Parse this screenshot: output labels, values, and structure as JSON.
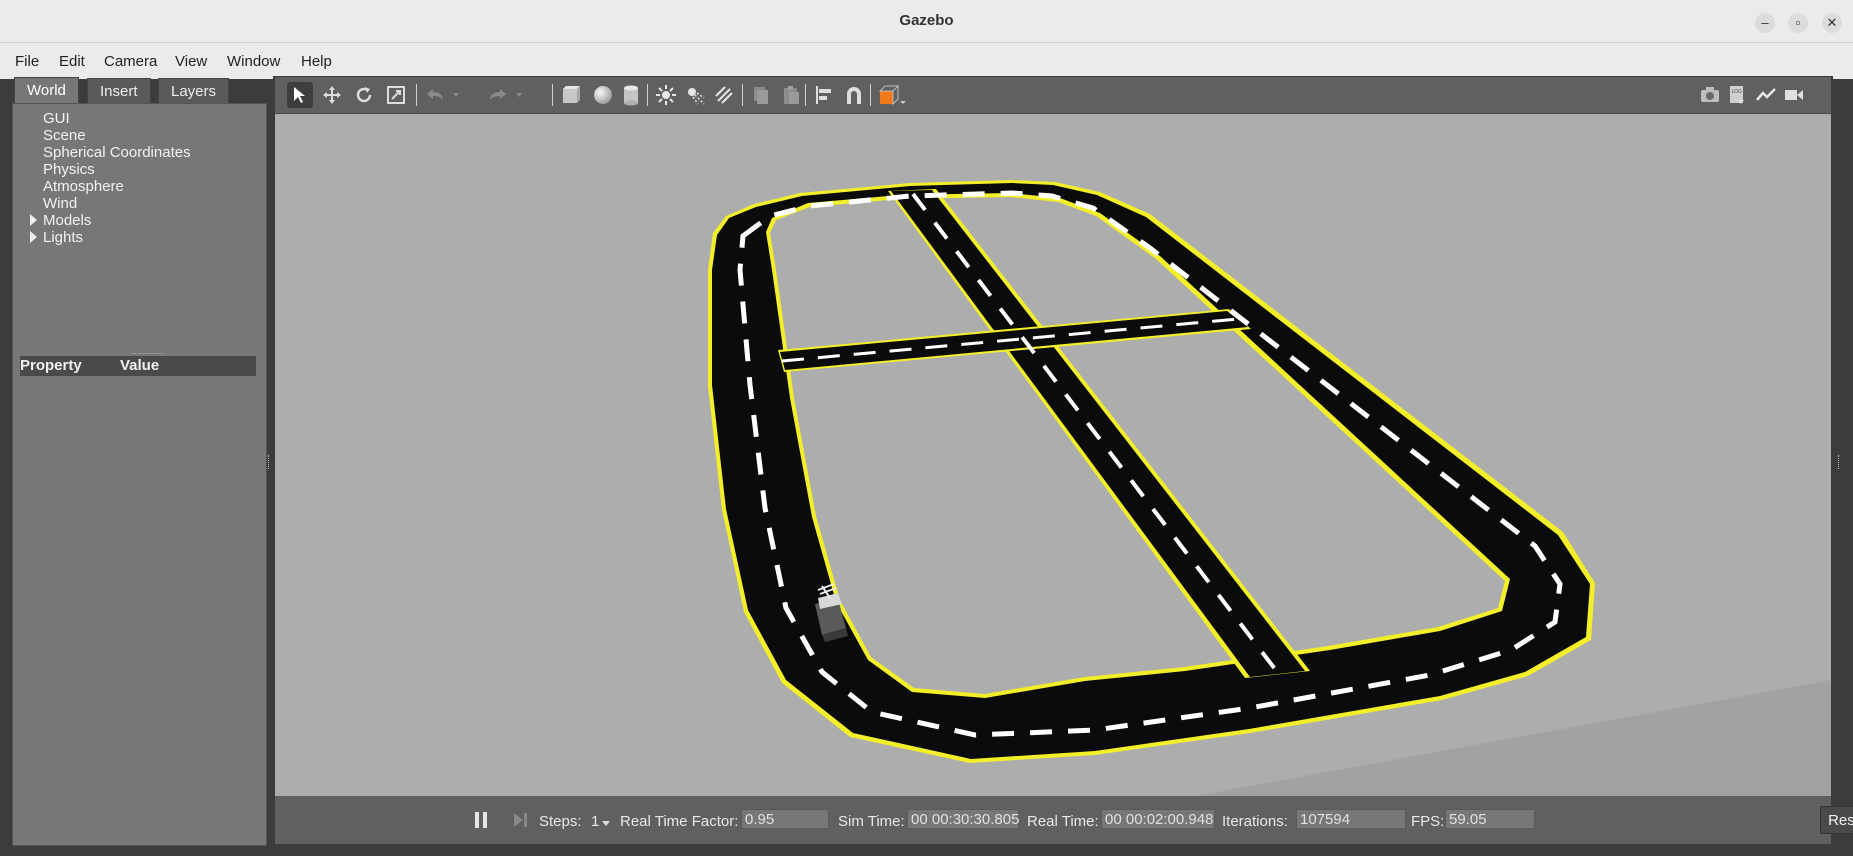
{
  "window": {
    "title": "Gazebo"
  },
  "menubar": {
    "items": [
      "File",
      "Edit",
      "Camera",
      "View",
      "Window",
      "Help"
    ]
  },
  "left_panel": {
    "tabs": [
      "World",
      "Insert",
      "Layers"
    ],
    "active_tab": "World",
    "tree": [
      {
        "label": "GUI",
        "expandable": false
      },
      {
        "label": "Scene",
        "expandable": false
      },
      {
        "label": "Spherical Coordinates",
        "expandable": false
      },
      {
        "label": "Physics",
        "expandable": false
      },
      {
        "label": "Atmosphere",
        "expandable": false
      },
      {
        "label": "Wind",
        "expandable": false
      },
      {
        "label": "Models",
        "expandable": true
      },
      {
        "label": "Lights",
        "expandable": true
      }
    ],
    "property_header": {
      "property": "Property",
      "value": "Value"
    }
  },
  "toolbar": {
    "left_tools": [
      "select-tool",
      "translate-tool",
      "rotate-tool",
      "scale-tool",
      "undo",
      "undo-history",
      "redo",
      "redo-history",
      "box-shape",
      "sphere-shape",
      "cylinder-shape",
      "point-light",
      "spot-light",
      "directional-light",
      "copy",
      "paste",
      "align",
      "snap",
      "view-angle"
    ],
    "right_tools": [
      "screenshot",
      "log",
      "plot",
      "record-video"
    ]
  },
  "status": {
    "steps_label": "Steps:",
    "steps_value": "1",
    "rtf_label": "Real Time Factor:",
    "rtf_value": "0.95",
    "sim_time_label": "Sim Time:",
    "sim_time_value": "00 00:30:30.805",
    "real_time_label": "Real Time:",
    "real_time_value": "00 00:02:00.948",
    "iterations_label": "Iterations:",
    "iterations_value": "107594",
    "fps_label": "FPS:",
    "fps_value": "59.05",
    "reset_label": "Reset Time"
  },
  "colors": {
    "road": "#0b0b0b",
    "road_edge": "#f2ef2a",
    "lane_marking": "#ffffff",
    "ground": "#adadad",
    "panel": "#777777",
    "toolbar": "#606060"
  }
}
